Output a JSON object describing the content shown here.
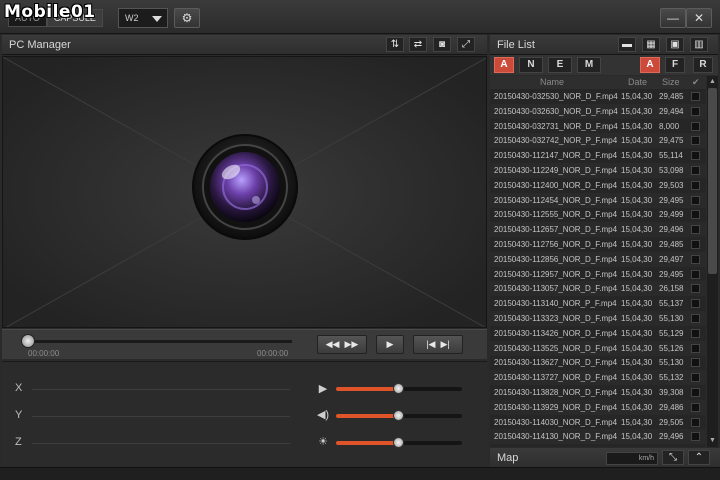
{
  "watermark": "Mobile01",
  "top": {
    "modes": [
      "AUTO",
      "CAPSULE"
    ],
    "profile": "W2"
  },
  "pc_manager": {
    "title": "PC Manager"
  },
  "player": {
    "time_current": "00:00:00",
    "time_total": "00:00:00"
  },
  "sensor": {
    "axes": [
      "X",
      "Y",
      "Z"
    ],
    "sliders": [
      {
        "name": "speed",
        "icon": "playback-speed-icon",
        "value": 0.5
      },
      {
        "name": "volume",
        "icon": "volume-icon",
        "value": 0.5
      },
      {
        "name": "brightness",
        "icon": "brightness-icon",
        "value": 0.5
      }
    ]
  },
  "file_list": {
    "title": "File List",
    "filters_left": [
      "A",
      "N",
      "E",
      "M"
    ],
    "filters_right": [
      "A",
      "F",
      "R"
    ],
    "columns": {
      "name": "Name",
      "date": "Date",
      "size": "Size"
    },
    "rows": [
      {
        "name": "20150430-032530_NOR_D_F.mp4",
        "date": "15,04,30",
        "size": "29,485"
      },
      {
        "name": "20150430-032630_NOR_D_F.mp4",
        "date": "15,04,30",
        "size": "29,494"
      },
      {
        "name": "20150430-032731_NOR_D_F.mp4",
        "date": "15,04,30",
        "size": "8,000"
      },
      {
        "name": "20150430-032742_NOR_P_F.mp4",
        "date": "15,04,30",
        "size": "29,475"
      },
      {
        "name": "20150430-112147_NOR_D_F.mp4",
        "date": "15,04,30",
        "size": "55,114"
      },
      {
        "name": "20150430-112249_NOR_D_F.mp4",
        "date": "15,04,30",
        "size": "53,098"
      },
      {
        "name": "20150430-112400_NOR_D_F.mp4",
        "date": "15,04,30",
        "size": "29,503"
      },
      {
        "name": "20150430-112454_NOR_D_F.mp4",
        "date": "15,04,30",
        "size": "29,495"
      },
      {
        "name": "20150430-112555_NOR_D_F.mp4",
        "date": "15,04,30",
        "size": "29,499"
      },
      {
        "name": "20150430-112657_NOR_D_F.mp4",
        "date": "15,04,30",
        "size": "29,496"
      },
      {
        "name": "20150430-112756_NOR_D_F.mp4",
        "date": "15,04,30",
        "size": "29,485"
      },
      {
        "name": "20150430-112856_NOR_D_F.mp4",
        "date": "15,04,30",
        "size": "29,497"
      },
      {
        "name": "20150430-112957_NOR_D_F.mp4",
        "date": "15,04,30",
        "size": "29,495"
      },
      {
        "name": "20150430-113057_NOR_D_F.mp4",
        "date": "15,04,30",
        "size": "26,158"
      },
      {
        "name": "20150430-113140_NOR_P_F.mp4",
        "date": "15,04,30",
        "size": "55,137"
      },
      {
        "name": "20150430-113323_NOR_D_F.mp4",
        "date": "15,04,30",
        "size": "55,130"
      },
      {
        "name": "20150430-113426_NOR_D_F.mp4",
        "date": "15,04,30",
        "size": "55,129"
      },
      {
        "name": "20150430-113525_NOR_D_F.mp4",
        "date": "15,04,30",
        "size": "55,126"
      },
      {
        "name": "20150430-113627_NOR_D_F.mp4",
        "date": "15,04,30",
        "size": "55,130"
      },
      {
        "name": "20150430-113727_NOR_D_F.mp4",
        "date": "15,04,30",
        "size": "55,132"
      },
      {
        "name": "20150430-113828_NOR_D_F.mp4",
        "date": "15,04,30",
        "size": "39,308"
      },
      {
        "name": "20150430-113929_NOR_D_F.mp4",
        "date": "15,04,30",
        "size": "29,486"
      },
      {
        "name": "20150430-114030_NOR_D_F.mp4",
        "date": "15,04,30",
        "size": "29,505"
      },
      {
        "name": "20150430-114130_NOR_D_F.mp4",
        "date": "15,04,30",
        "size": "29,496"
      }
    ]
  },
  "map": {
    "title": "Map",
    "speed_unit": "km/h"
  },
  "colors": {
    "accent": "#e0542a",
    "filter_active": "#cc4a3a"
  }
}
